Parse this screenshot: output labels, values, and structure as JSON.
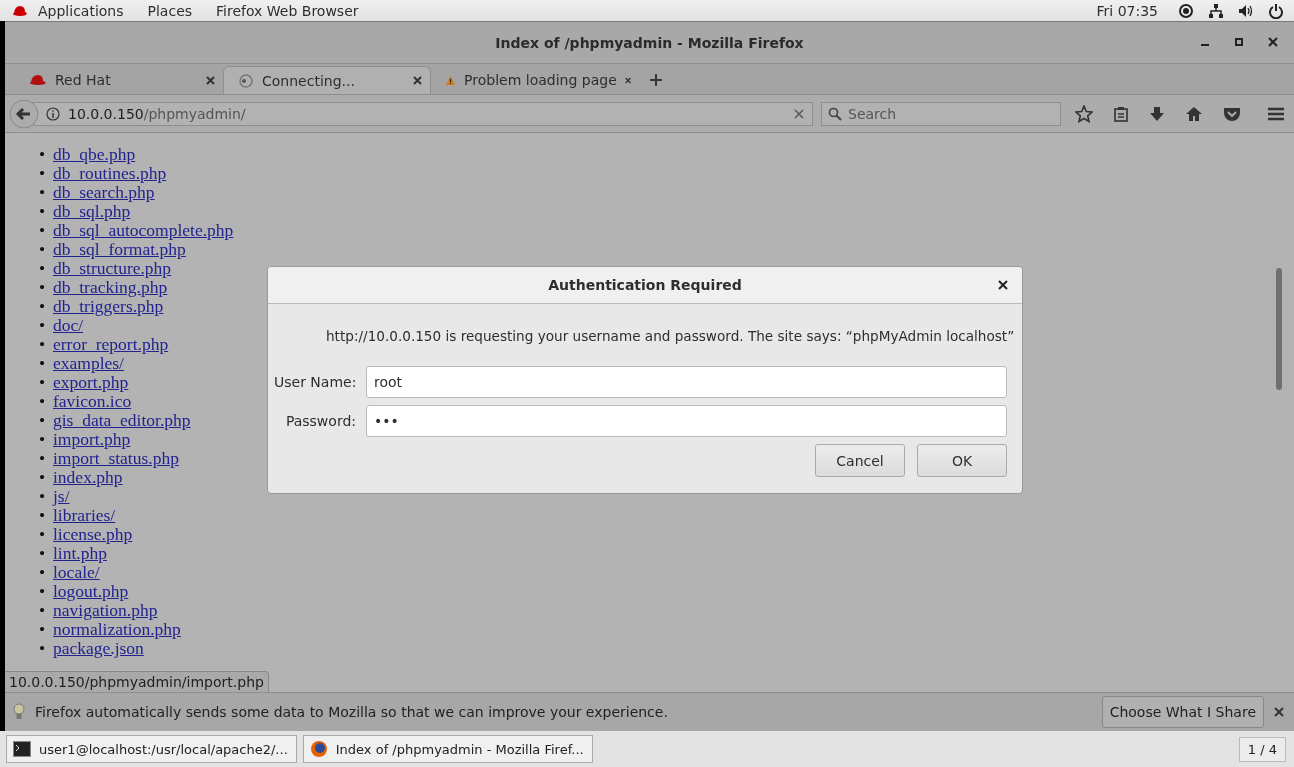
{
  "top_bar": {
    "menus": [
      "Applications",
      "Places",
      "Firefox Web Browser"
    ],
    "clock": "Fri 07:35"
  },
  "window": {
    "title": "Index of /phpmyadmin - Mozilla Firefox"
  },
  "tabs": [
    {
      "label": "Red Hat",
      "kind": "hat",
      "selected": false
    },
    {
      "label": "Connecting...",
      "kind": "loading",
      "selected": true
    },
    {
      "label": "Problem loading page",
      "kind": "warning",
      "selected": false
    }
  ],
  "address": {
    "host": "10.0.0.150",
    "path": "/phpmyadmin/"
  },
  "search": {
    "placeholder": "Search"
  },
  "bullet": "•",
  "files": [
    "db_qbe.php",
    "db_routines.php",
    "db_search.php",
    "db_sql.php",
    "db_sql_autocomplete.php",
    "db_sql_format.php",
    "db_structure.php",
    "db_tracking.php",
    "db_triggers.php",
    "doc/",
    "error_report.php",
    "examples/",
    "export.php",
    "favicon.ico",
    "gis_data_editor.php",
    "import.php",
    "import_status.php",
    "index.php",
    "js/",
    "libraries/",
    "license.php",
    "lint.php",
    "locale/",
    "logout.php",
    "navigation.php",
    "normalization.php",
    "package.json"
  ],
  "status_link": "10.0.0.150/phpmyadmin/import.php",
  "notification": {
    "message": "Firefox automatically sends some data to Mozilla so that we can improve your experience.",
    "button": "Choose What I Share"
  },
  "dialog": {
    "title": "Authentication Required",
    "message": "http://10.0.0.150 is requesting your username and password. The site says: “phpMyAdmin localhost”",
    "fields": [
      {
        "label": "User Name:",
        "value": "root"
      },
      {
        "label": "Password:",
        "value": "•••"
      }
    ],
    "buttons": [
      "Cancel",
      "OK"
    ]
  },
  "taskbar": {
    "items": [
      {
        "label": "user1@localhost:/usr/local/apache2/...",
        "kind": "terminal"
      },
      {
        "label": "Index of /phpmyadmin - Mozilla Firef...",
        "kind": "firefox"
      }
    ],
    "workspace": "1 / 4"
  }
}
